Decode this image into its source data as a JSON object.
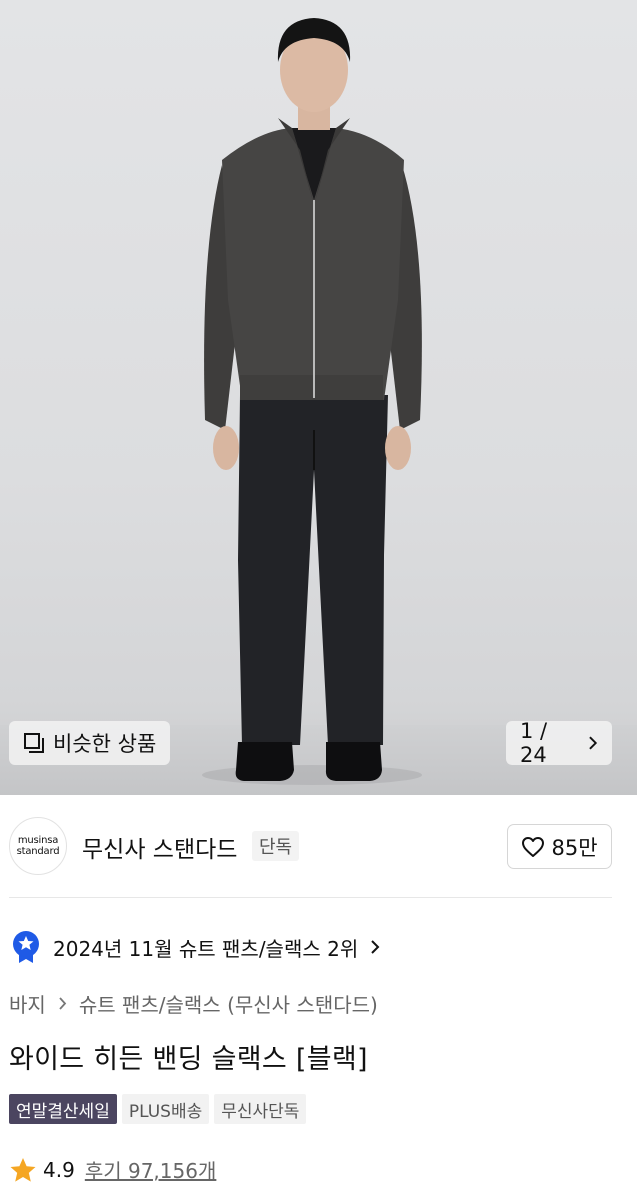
{
  "hero": {
    "similar_label": "비슷한 상품",
    "similar_icon": "similar-items-icon",
    "counter": "1 / 24",
    "counter_icon": "chevron-right-icon"
  },
  "brand": {
    "logo_line1": "musinsa",
    "logo_line2": "standard",
    "name": "무신사 스탠다드",
    "badge": "단독",
    "like_icon": "heart-outline-icon",
    "like_count": "85만"
  },
  "ranking": {
    "icon": "ranking-badge-icon",
    "text": "2024년 11월 슈트 팬츠/슬랙스 2위",
    "accent": "#1f5ae6"
  },
  "breadcrumb": {
    "items": [
      "바지",
      "슈트 팬츠/슬랙스 (무신사 스탠다드)"
    ]
  },
  "product": {
    "title": "와이드 히든 밴딩 슬랙스 [블랙]",
    "tags": [
      "연말결산세일",
      "PLUS배송",
      "무신사단독"
    ]
  },
  "rating": {
    "icon": "star-icon",
    "star_color": "#f5a623",
    "score": "4.9",
    "reviews": "후기 97,156개"
  }
}
